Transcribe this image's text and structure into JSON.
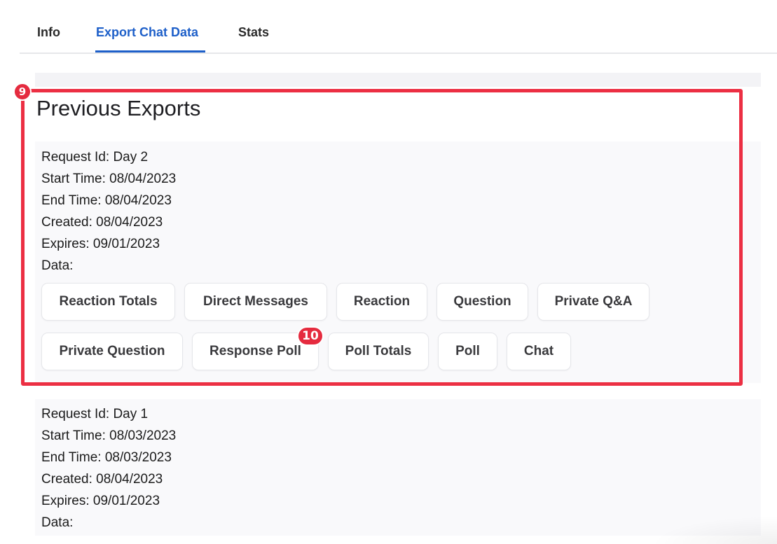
{
  "tabs": [
    {
      "label": "Info",
      "active": false
    },
    {
      "label": "Export Chat Data",
      "active": true
    },
    {
      "label": "Stats",
      "active": false
    }
  ],
  "section_title": "Previous Exports",
  "exports": [
    {
      "request_id": "Request Id: Day 2",
      "start_time": "Start Time: 08/04/2023",
      "end_time": "End Time: 08/04/2023",
      "created": "Created: 08/04/2023",
      "expires": "Expires: 09/01/2023",
      "data_label": "Data:",
      "data_types": [
        "Reaction Totals",
        "Direct Messages",
        "Reaction",
        "Question",
        "Private Q&A",
        "Private Question",
        "Response Poll",
        "Poll Totals",
        "Poll",
        "Chat"
      ]
    },
    {
      "request_id": "Request Id: Day 1",
      "start_time": "Start Time: 08/03/2023",
      "end_time": "End Time: 08/03/2023",
      "created": "Created: 08/04/2023",
      "expires": "Expires: 09/01/2023",
      "data_label": "Data:"
    }
  ],
  "annotations": {
    "marker_1": "9",
    "marker_2": "10"
  },
  "colors": {
    "accent": "#1d5fc9",
    "annotation": "#ec2f43"
  }
}
